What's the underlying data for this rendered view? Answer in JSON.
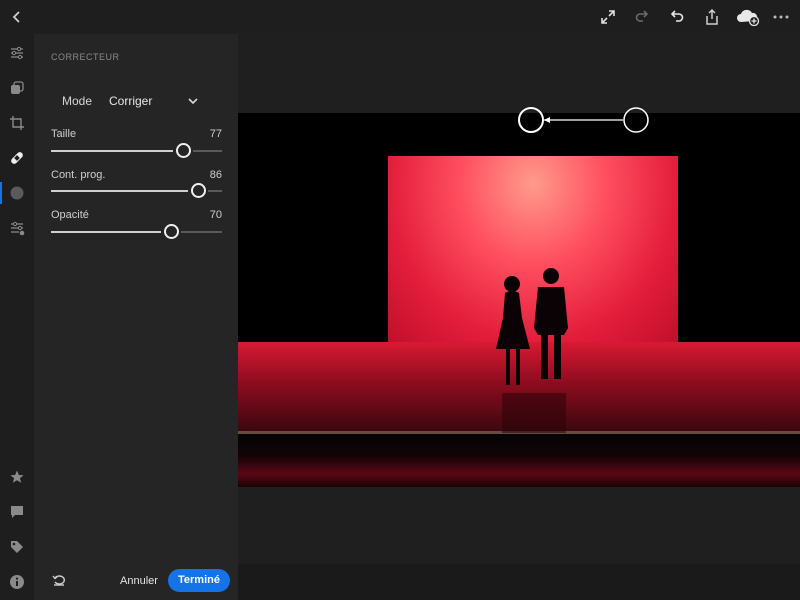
{
  "panel": {
    "title": "CORRECTEUR",
    "mode": {
      "label": "Mode",
      "value": "Corriger"
    },
    "sliders": [
      {
        "label": "Taille",
        "value": "77",
        "fraction": 0.77
      },
      {
        "label": "Cont. prog.",
        "value": "86",
        "fraction": 0.86
      },
      {
        "label": "Opacité",
        "value": "70",
        "fraction": 0.7
      }
    ],
    "cancel_label": "Annuler",
    "done_label": "Terminé"
  },
  "toolbar_icons": [
    "back-icon",
    "fullscreen-icon",
    "redo-icon",
    "undo-icon",
    "share-icon",
    "cloud-sync-icon",
    "more-icon"
  ],
  "rail_icons": [
    "edit-sliders-icon",
    "presets-icon",
    "crop-icon",
    "healing-brush-icon",
    "masking-icon",
    "versions-icon",
    "rating-icon",
    "comments-icon",
    "tags-icon",
    "info-icon"
  ],
  "colors": {
    "accent": "#1473e6",
    "panel": "#252525",
    "background": "#1a1a1a"
  }
}
